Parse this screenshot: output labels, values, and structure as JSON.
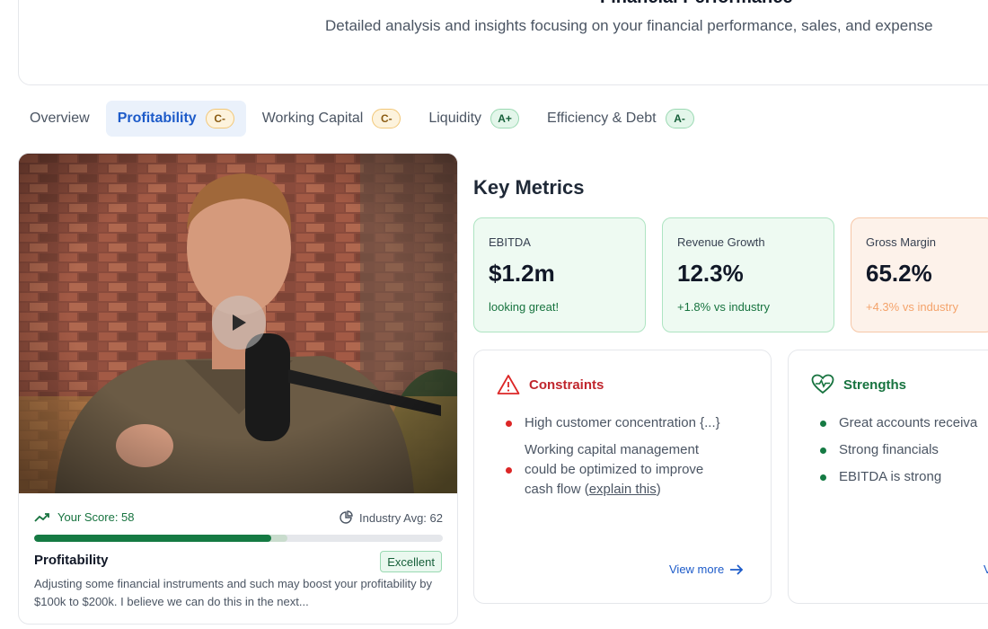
{
  "header": {
    "title": "Financial Performance",
    "subtitle": "Detailed analysis and insights focusing on your financial performance, sales, and expense"
  },
  "tabs": [
    {
      "label": "Overview",
      "grade": ""
    },
    {
      "label": "Profitability",
      "grade": "C-",
      "active": true
    },
    {
      "label": "Working Capital",
      "grade": "C-"
    },
    {
      "label": "Liquidity",
      "grade": "A+"
    },
    {
      "label": "Efficiency & Debt",
      "grade": "A-"
    }
  ],
  "score_card": {
    "your_score_label": "Your Score: 58",
    "your_score": 58,
    "industry_avg_label": "Industry Avg: 62",
    "industry_avg": 62,
    "title": "Profitability",
    "badge": "Excellent",
    "description": "Adjusting some financial instruments and such may boost your profitability by $100k to $200k. I believe we can do this in the next..."
  },
  "key_metrics": {
    "title": "Key Metrics",
    "items": [
      {
        "label": "EBITDA",
        "value": "$1.2m",
        "note": "looking great!",
        "tone": "green"
      },
      {
        "label": "Revenue Growth",
        "value": "12.3%",
        "note": "+1.8% vs industry",
        "tone": "green"
      },
      {
        "label": "Gross Margin",
        "value": "65.2%",
        "note": "+4.3% vs industry",
        "tone": "orange"
      }
    ]
  },
  "constraints": {
    "title": "Constraints",
    "items": [
      "High customer concentration {...}"
    ],
    "item2_line1": "Working capital management",
    "item2_line2": "could be optimized to improve",
    "item2_line3_prefix": "cash flow (",
    "item2_link": "explain this",
    "item2_line3_suffix": ")",
    "view_more": "View more"
  },
  "strengths": {
    "title": "Strengths",
    "items": [
      "Great accounts receiva",
      "Strong financials",
      "EBITDA is strong"
    ],
    "view_more": "V"
  },
  "colors": {
    "accent_blue": "#1d5bc9",
    "green": "#157a43",
    "red": "#dc2626",
    "orange": "#f4a36b"
  }
}
